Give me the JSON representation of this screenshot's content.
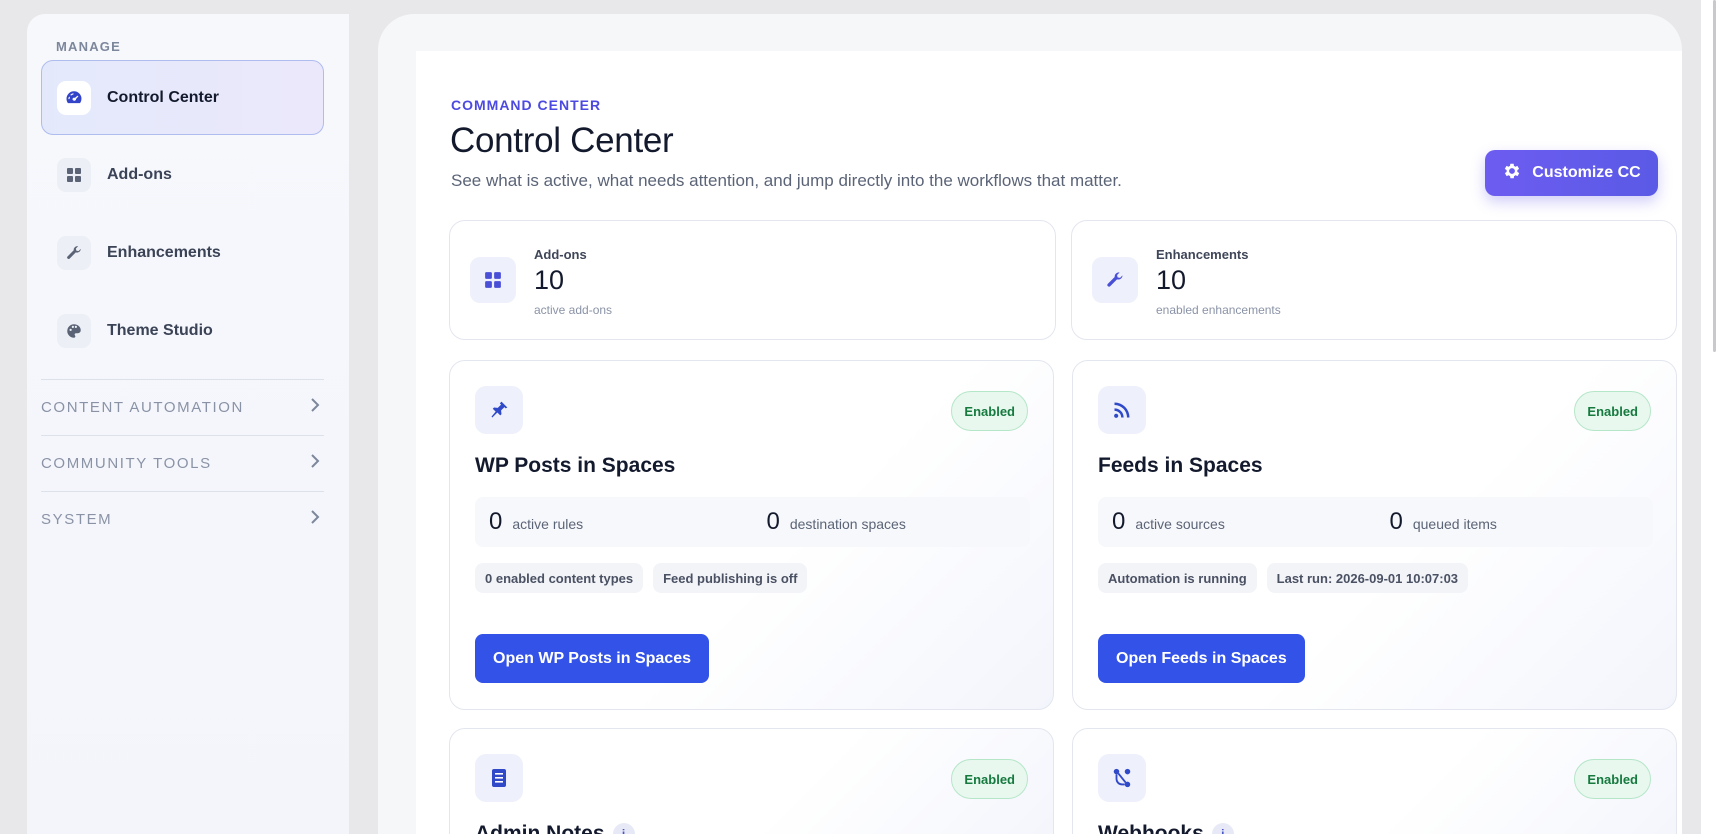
{
  "sidebar": {
    "heading": "MANAGE",
    "items": [
      {
        "label": "Control Center",
        "icon": "gauge-icon",
        "active": true
      },
      {
        "label": "Add-ons",
        "icon": "grid-icon",
        "active": false
      },
      {
        "label": "Enhancements",
        "icon": "wrench-icon",
        "active": false
      },
      {
        "label": "Theme Studio",
        "icon": "palette-icon",
        "active": false
      }
    ],
    "groups": [
      {
        "label": "CONTENT AUTOMATION"
      },
      {
        "label": "COMMUNITY TOOLS"
      },
      {
        "label": "SYSTEM"
      }
    ]
  },
  "header": {
    "eyebrow": "COMMAND CENTER",
    "title": "Control Center",
    "subtitle": "See what is active, what needs attention, and jump directly into the workflows that matter.",
    "customize_label": "Customize CC"
  },
  "stats": [
    {
      "label": "Add-ons",
      "value": "10",
      "sub": "active add-ons",
      "icon": "grid-icon"
    },
    {
      "label": "Enhancements",
      "value": "10",
      "sub": "enabled enhancements",
      "icon": "wrench-icon"
    }
  ],
  "features": [
    {
      "title": "WP Posts in Spaces",
      "icon": "pin-icon",
      "badge": "Enabled",
      "metrics": [
        {
          "value": "0",
          "label": "active rules"
        },
        {
          "value": "0",
          "label": "destination spaces"
        }
      ],
      "pills": [
        "0 enabled content types",
        "Feed publishing is off"
      ],
      "button": "Open WP Posts in Spaces"
    },
    {
      "title": "Feeds in Spaces",
      "icon": "rss-icon",
      "badge": "Enabled",
      "metrics": [
        {
          "value": "0",
          "label": "active sources"
        },
        {
          "value": "0",
          "label": "queued items"
        }
      ],
      "pills": [
        "Automation is running",
        "Last run: 2026-09-01 10:07:03"
      ],
      "button": "Open Feeds in Spaces"
    },
    {
      "title": "Admin Notes",
      "icon": "document-icon",
      "badge": "Enabled",
      "info": "i"
    },
    {
      "title": "Webhooks",
      "icon": "webhook-icon",
      "badge": "Enabled",
      "info": "i"
    }
  ],
  "colors": {
    "accent": "#4c4ae0",
    "primary_button": "#3352e8",
    "enabled_badge_bg": "#e8f8ef",
    "enabled_badge_text": "#167a3f"
  }
}
